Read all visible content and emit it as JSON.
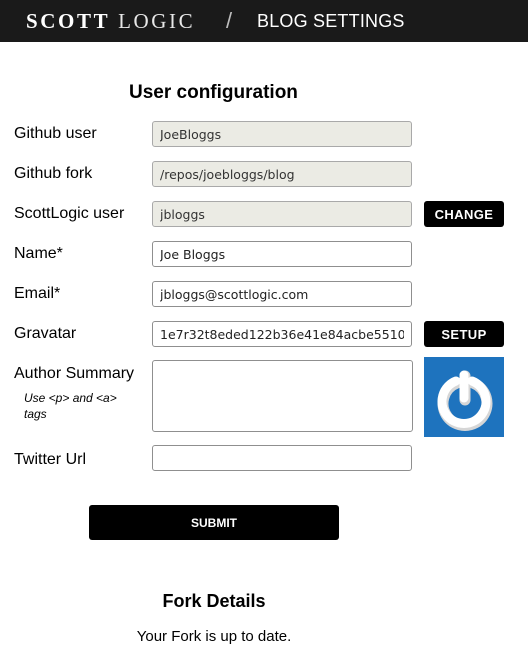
{
  "header": {
    "logo_word1": "SCOTT",
    "logo_word2": "LOGIC",
    "separator": "/",
    "page_title": "BLOG SETTINGS"
  },
  "user_config": {
    "title": "User configuration",
    "github_user": {
      "label": "Github user",
      "value": "JoeBloggs"
    },
    "github_fork": {
      "label": "Github fork",
      "value": "/repos/joebloggs/blog"
    },
    "scottlogic_user": {
      "label": "ScottLogic user",
      "value": "jbloggs",
      "button": "CHANGE"
    },
    "name": {
      "label": "Name*",
      "value": "Joe Bloggs"
    },
    "email": {
      "label": "Email*",
      "value": "jbloggs@scottlogic.com"
    },
    "gravatar": {
      "label": "Gravatar",
      "value": "1e7r32t8eded122b36e41e84acbe5510",
      "button": "SETUP",
      "icon": "gravatar-logo-icon"
    },
    "author_summary": {
      "label": "Author Summary",
      "hint": "Use <p> and <a> tags",
      "value": ""
    },
    "twitter_url": {
      "label": "Twitter Url",
      "value": ""
    },
    "submit_label": "SUBMIT"
  },
  "fork_details": {
    "title": "Fork Details",
    "status": "Your Fork is up to date."
  },
  "colors": {
    "header_bg": "#1a1a1a",
    "button_bg": "#000000",
    "readonly_bg": "#ebebe4",
    "gravatar_bg": "#1e73be"
  }
}
